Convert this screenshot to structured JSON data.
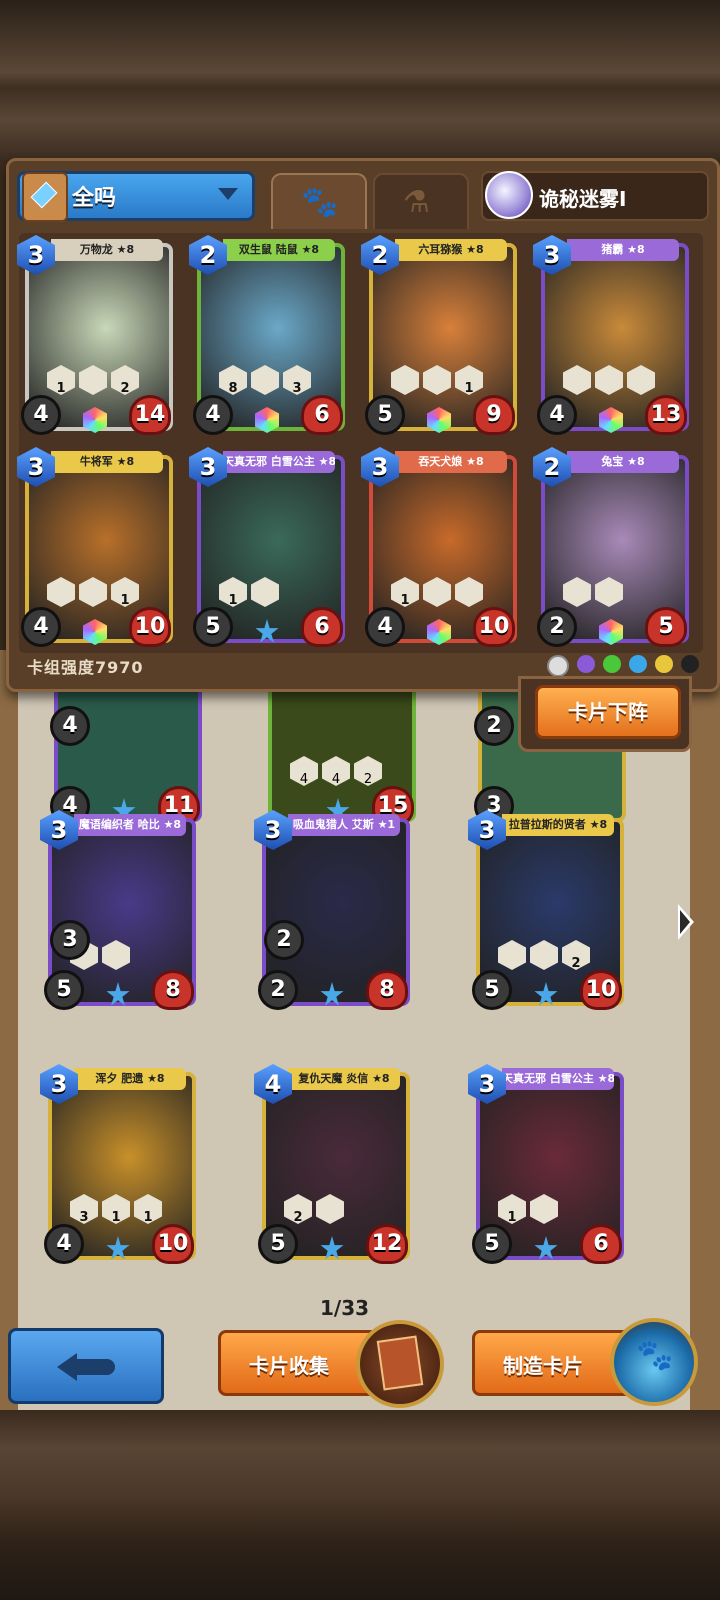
{
  "deck": {
    "filter_label": "全吗",
    "mode_name": "诡秘迷雾I",
    "power_label": "卡组强度7970",
    "tabs": [
      "paw-icon",
      "potion-icon"
    ]
  },
  "deck_cards": [
    {
      "name": "万物龙 ★8",
      "cost": "3",
      "atk": "4",
      "hp": "14",
      "color": "silver",
      "skills": [
        "1",
        "",
        "2"
      ],
      "art": "#c8d8b8"
    },
    {
      "name": "双生鼠 陆鼠 ★8",
      "cost": "2",
      "atk": "4",
      "hp": "6",
      "color": "green",
      "skills": [
        "8",
        "",
        "3"
      ],
      "art": "#6aa8c8"
    },
    {
      "name": "六耳猕猴 ★8",
      "cost": "2",
      "atk": "5",
      "hp": "9",
      "color": "gold",
      "skills": [
        "",
        "",
        "1"
      ],
      "art": "#d8803a"
    },
    {
      "name": "猪霸 ★8",
      "cost": "3",
      "atk": "4",
      "hp": "13",
      "color": "purple",
      "skills": [
        "",
        "",
        ""
      ],
      "art": "#c88a3a"
    },
    {
      "name": "牛将军 ★8",
      "cost": "3",
      "atk": "4",
      "hp": "10",
      "color": "gold",
      "skills": [
        "",
        "",
        "1"
      ],
      "art": "#b8702a"
    },
    {
      "name": "天真无邪 白雪公主 ★8",
      "cost": "3",
      "atk": "5",
      "hp": "6",
      "color": "purple",
      "skills": [
        "1",
        ""
      ],
      "art": "#3a6a5a"
    },
    {
      "name": "吞天犬娘 ★8",
      "cost": "3",
      "atk": "4",
      "hp": "10",
      "color": "red",
      "skills": [
        "1",
        "",
        ""
      ],
      "art": "#c86a2a"
    },
    {
      "name": "兔宝 ★8",
      "cost": "2",
      "atk": "2",
      "hp": "5",
      "color": "purple",
      "skills": [
        "",
        ""
      ],
      "art": "#a88ab8"
    }
  ],
  "down_button": "卡片下阵",
  "partial_cards": [
    {
      "atk1": "4",
      "atk2": "4",
      "hp": "11",
      "skills": [
        "",
        ""
      ]
    },
    {
      "hp": "15",
      "skills": [
        "4",
        "4",
        "2"
      ]
    },
    {
      "atk1": "2",
      "atk2": "3",
      "hp": ""
    }
  ],
  "collection_cards": [
    {
      "name": "魔语编织者 哈比 ★8",
      "cost": "3",
      "atk": "5",
      "hp": "8",
      "color": "purple",
      "skills": [
        "",
        ""
      ],
      "extra": "3",
      "art": "#4a3a8a"
    },
    {
      "name": "吸血鬼猎人 艾斯 ★1",
      "cost": "3",
      "atk": "2",
      "hp": "8",
      "color": "purple",
      "skills": [],
      "extra": "2",
      "art": "#2a2a4a"
    },
    {
      "name": "拉普拉斯的贤者 ★8",
      "cost": "3",
      "atk": "5",
      "hp": "10",
      "color": "gold",
      "skills": [
        "",
        "",
        "2"
      ],
      "extra": "",
      "art": "#2a3a6a"
    },
    {
      "name": "浑夕 肥遗 ★8",
      "cost": "3",
      "atk": "4",
      "hp": "10",
      "color": "gold",
      "skills": [
        "3",
        "1",
        "1"
      ],
      "extra": "",
      "art": "#c8902a"
    },
    {
      "name": "复仇天魔 炎信 ★8",
      "cost": "4",
      "atk": "5",
      "hp": "12",
      "color": "gold",
      "skills": [
        "2",
        ""
      ],
      "extra": "",
      "art": "#4a2a3a"
    },
    {
      "name": "天真无邪 白雪公主 ★8",
      "cost": "3",
      "atk": "5",
      "hp": "6",
      "color": "purple",
      "skills": [
        "1",
        ""
      ],
      "extra": "",
      "art": "#6a2a3a"
    }
  ],
  "pager": "1/33",
  "bottom": {
    "collect_label": "卡片收集",
    "craft_label": "制造卡片"
  }
}
